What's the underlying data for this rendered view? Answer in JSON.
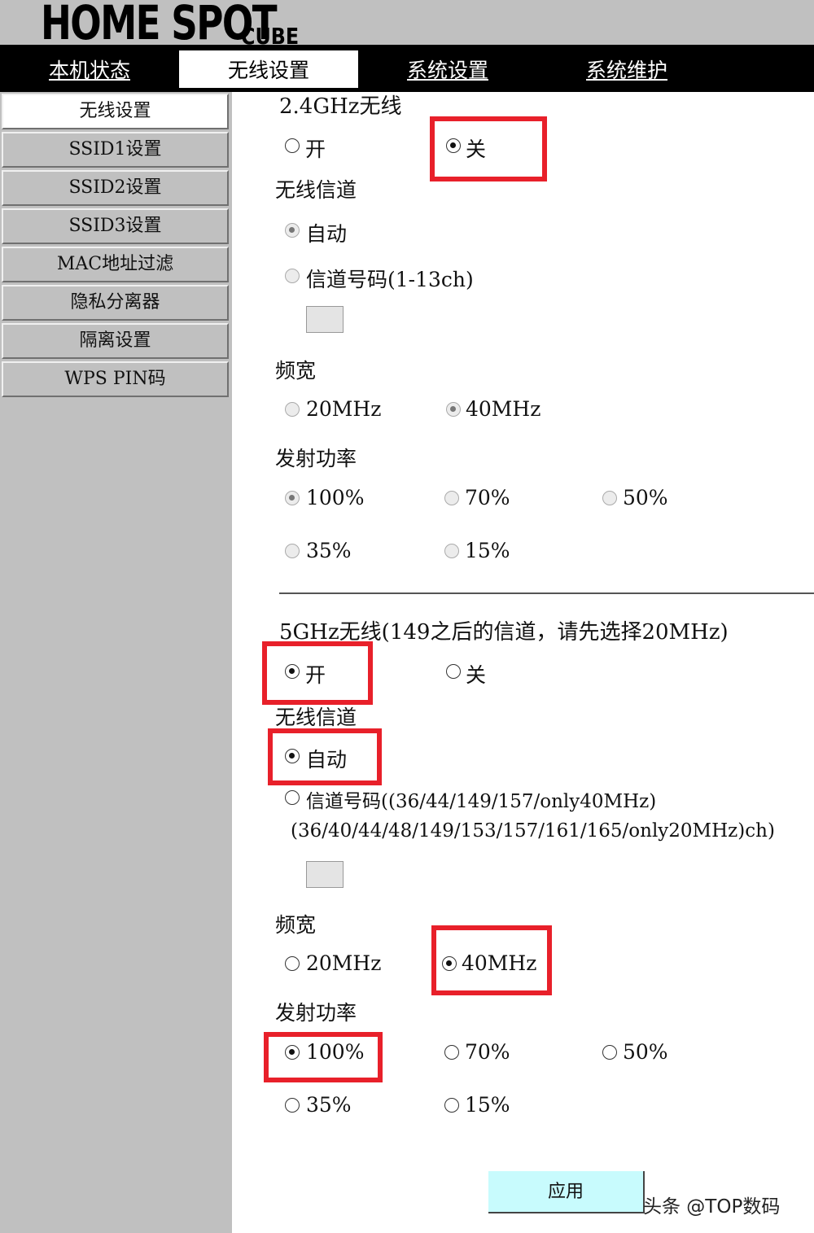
{
  "header": {
    "logo": "HOME SPOT",
    "logo_sub": "CUBE"
  },
  "nav": {
    "tabs": [
      {
        "label": "本机状态",
        "active": false
      },
      {
        "label": "无线设置",
        "active": true
      },
      {
        "label": "系统设置",
        "active": false
      },
      {
        "label": "系统维护",
        "active": false
      }
    ]
  },
  "sidebar": {
    "items": [
      {
        "label": "无线设置",
        "active": true
      },
      {
        "label": "SSID1设置",
        "active": false
      },
      {
        "label": "SSID2设置",
        "active": false
      },
      {
        "label": "SSID3设置",
        "active": false
      },
      {
        "label": "MAC地址过滤",
        "active": false
      },
      {
        "label": "隐私分离器",
        "active": false
      },
      {
        "label": "隔离设置",
        "active": false
      },
      {
        "label": "WPS PIN码",
        "active": false
      }
    ]
  },
  "band24": {
    "title": "2.4GHz无线",
    "on_label": "开",
    "off_label": "关",
    "enabled": false,
    "channel_title": "无线信道",
    "channel_auto": "自动",
    "channel_number": "信道号码(1-13ch)",
    "channel_value": "",
    "bandwidth_title": "频宽",
    "bw_20": "20MHz",
    "bw_40": "40MHz",
    "power_title": "发射功率",
    "power": {
      "p100": "100%",
      "p70": "70%",
      "p50": "50%",
      "p35": "35%",
      "p15": "15%"
    }
  },
  "band5": {
    "title": "5GHz无线(149之后的信道，请先选择20MHz)",
    "on_label": "开",
    "off_label": "关",
    "enabled": true,
    "channel_title": "无线信道",
    "channel_auto": "自动",
    "channel_number": "信道号码((36/44/149/157/only40MHz)",
    "channel_number_line2": "(36/40/44/48/149/153/157/161/165/only20MHz)ch)",
    "channel_value": "",
    "bandwidth_title": "频宽",
    "bw_20": "20MHz",
    "bw_40": "40MHz",
    "power_title": "发射功率",
    "power": {
      "p100": "100%",
      "p70": "70%",
      "p50": "50%",
      "p35": "35%",
      "p15": "15%"
    }
  },
  "apply_label": "应用",
  "watermark": "头条 @TOP数码",
  "colors": {
    "highlight": "#e8202a",
    "apply_bg": "#c8fbfd",
    "sidebar_bg": "#c0c0c0",
    "nav_bg": "#000000"
  }
}
